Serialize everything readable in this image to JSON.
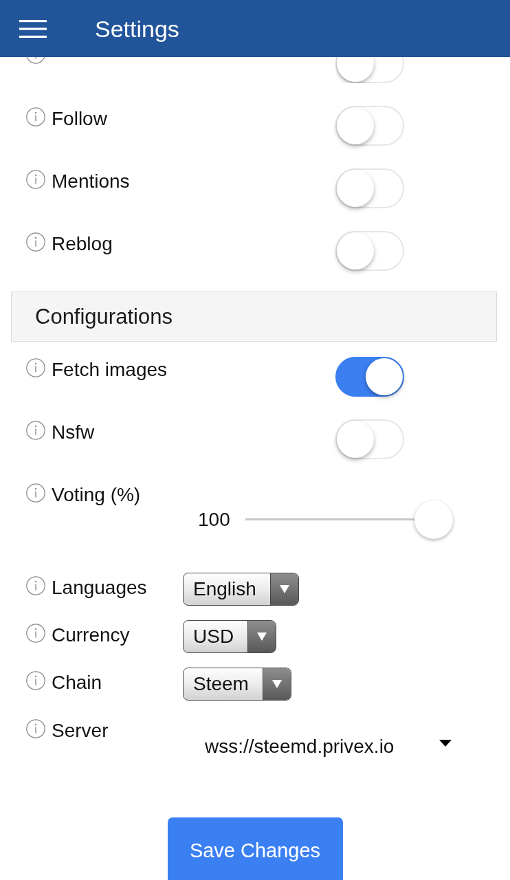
{
  "header": {
    "title": "Settings"
  },
  "notifications": [
    {
      "on": false
    },
    {
      "label": "Follow",
      "on": false
    },
    {
      "label": "Mentions",
      "on": false
    },
    {
      "label": "Reblog",
      "on": false
    }
  ],
  "configurations": {
    "title": "Configurations",
    "items": [
      {
        "kind": "toggle",
        "label": "Fetch images",
        "on": true
      },
      {
        "kind": "toggle",
        "label": "Nsfw",
        "on": false
      },
      {
        "kind": "slider",
        "label": "Voting (%)",
        "value": "100",
        "level": 1
      },
      {
        "kind": "select",
        "label": "Languages",
        "value": "English"
      },
      {
        "kind": "select",
        "label": "Currency",
        "value": "USD"
      },
      {
        "kind": "select",
        "label": "Chain",
        "value": "Steem"
      },
      {
        "kind": "dropdown",
        "label": "Server",
        "value": "wss://steemd.privex.io"
      }
    ]
  },
  "save_button": "Save Changes"
}
